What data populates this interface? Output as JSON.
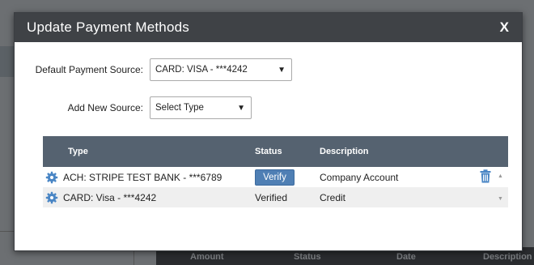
{
  "modal": {
    "title": "Update Payment Methods",
    "close_label": "X"
  },
  "form": {
    "default_source_label": "Default Payment Source:",
    "default_source_value": "CARD: VISA - ***4242",
    "add_source_label": "Add New Source:",
    "add_source_value": "Select Type"
  },
  "table": {
    "headers": {
      "type": "Type",
      "status": "Status",
      "description": "Description"
    },
    "rows": [
      {
        "type": "ACH: STRIPE TEST BANK - ***6789",
        "status": "Verify",
        "description": "Company Account"
      },
      {
        "type": "CARD: Visa - ***4242",
        "status": "Verified",
        "description": "Credit"
      }
    ]
  },
  "background": {
    "columns": [
      "Amount",
      "Status",
      "Date",
      "Description"
    ]
  },
  "colors": {
    "header_bg": "#3f4246",
    "table_header_bg": "#556270",
    "verify_button": "#4f7fb4",
    "icon_blue": "#4a86c5"
  },
  "icons": {
    "row_settings": "gear-icon",
    "delete": "trash-icon",
    "dropdown": "caret-down-icon"
  }
}
